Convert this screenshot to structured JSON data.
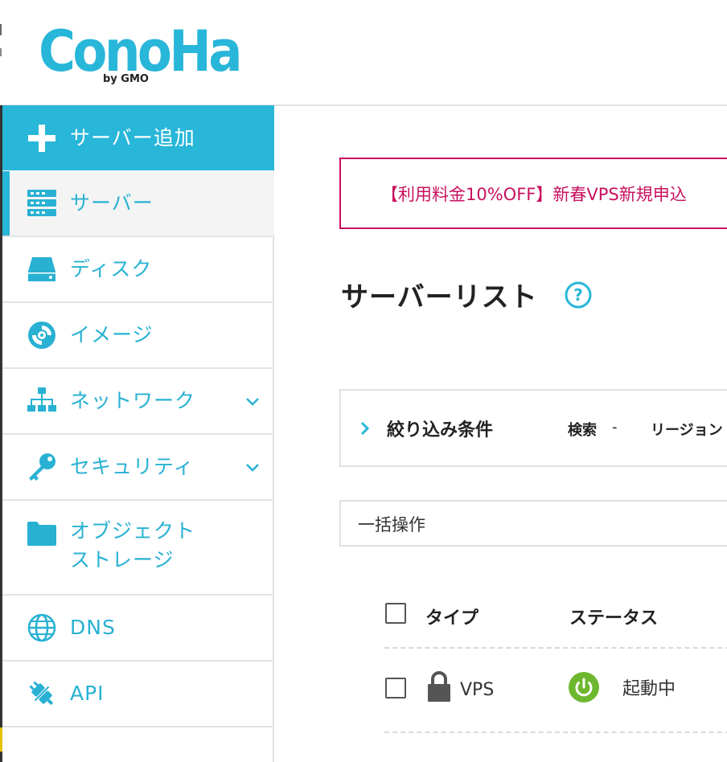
{
  "brand": {
    "logo_text": "ConoHa",
    "logo_sub": "by GMO",
    "accent": "#28b6d9"
  },
  "sidebar": {
    "add_label": "サーバー追加",
    "items": [
      {
        "label": "サーバー",
        "icon": "server-icon",
        "active": true
      },
      {
        "label": "ディスク",
        "icon": "disk-icon"
      },
      {
        "label": "イメージ",
        "icon": "image-disc-icon"
      },
      {
        "label": "ネットワーク",
        "icon": "network-icon",
        "expandable": true
      },
      {
        "label": "セキュリティ",
        "icon": "key-icon",
        "expandable": true
      },
      {
        "label": "オブジェクト",
        "label2": "ストレージ",
        "icon": "folder-icon"
      },
      {
        "label": "DNS",
        "icon": "globe-icon"
      },
      {
        "label": "API",
        "icon": "plug-icon"
      }
    ]
  },
  "banner": {
    "text": "【利用料金10%OFF】新春VPS新規申込",
    "color": "#c8115f"
  },
  "main": {
    "title": "サーバーリスト",
    "filter": {
      "label": "絞り込み条件",
      "search_label": "検索",
      "search_value": "-",
      "region_label": "リージョン"
    },
    "bulk_label": "一括操作",
    "table": {
      "headers": [
        "タイプ",
        "ステータス"
      ],
      "rows": [
        {
          "type": "VPS",
          "status": "起動中",
          "locked": true
        }
      ]
    }
  }
}
